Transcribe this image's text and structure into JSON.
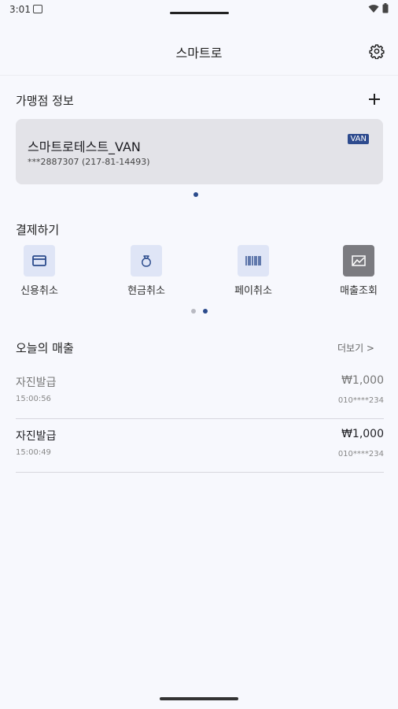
{
  "status": {
    "time": "3:01"
  },
  "header": {
    "title": "스마트로"
  },
  "merchant": {
    "section_title": "가맹점 정보",
    "name": "스마트로테스트_VAN",
    "id": "***2887307 (217-81-14493)",
    "badge": "VAN"
  },
  "payment": {
    "section_title": "결제하기",
    "items": [
      {
        "label": "신용취소",
        "icon": "credit-card-icon"
      },
      {
        "label": "현금취소",
        "icon": "money-bag-icon"
      },
      {
        "label": "페이취소",
        "icon": "barcode-icon"
      },
      {
        "label": "매출조회",
        "icon": "chart-icon"
      }
    ]
  },
  "sales": {
    "section_title": "오늘의 매출",
    "more_label": "더보기 >",
    "rows": [
      {
        "type": "자진발급",
        "time": "15:00:56",
        "amount": "₩1,000",
        "phone": "010****234"
      },
      {
        "type": "자진발급",
        "time": "15:00:49",
        "amount": "₩1,000",
        "phone": "010****234"
      }
    ]
  },
  "colors": {
    "accent": "#2b4b8c",
    "background": "#f7f8fd",
    "card": "#e3e3e8"
  }
}
